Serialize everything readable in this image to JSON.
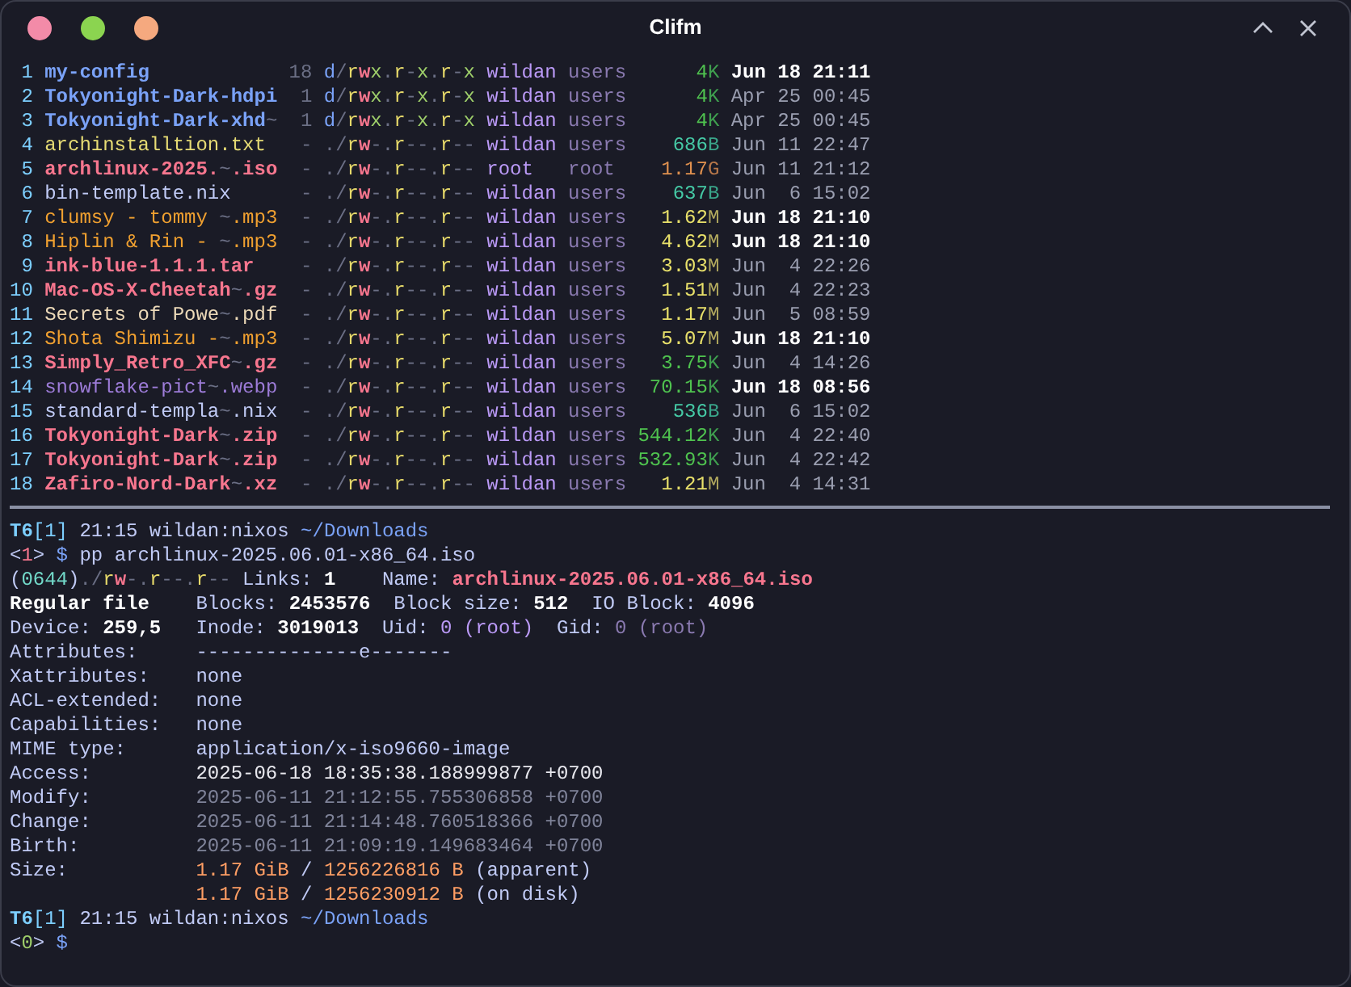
{
  "window": {
    "title": "Clifm"
  },
  "listing": [
    {
      "index": "1",
      "name": "my-config",
      "kind": "dir",
      "links": "18",
      "perms": "d/rwx.r-x.r-x",
      "owner": "wildan",
      "group": "users",
      "size": "4",
      "unit": "K",
      "date": "Jun 18 21:11",
      "recent": true
    },
    {
      "index": "2",
      "name": "Tokyonight-Dark-hdpi",
      "kind": "dir",
      "links": "1",
      "perms": "d/rwx.r-x.r-x",
      "owner": "wildan",
      "group": "users",
      "size": "4",
      "unit": "K",
      "date": "Apr 25 00:45",
      "recent": false
    },
    {
      "index": "3",
      "name": "Tokyonight-Dark-xhd~",
      "kind": "dir",
      "links": "1",
      "perms": "d/rwx.r-x.r-x",
      "owner": "wildan",
      "group": "users",
      "size": "4",
      "unit": "K",
      "date": "Apr 25 00:45",
      "recent": false
    },
    {
      "index": "4",
      "name": "archinstalltion.txt",
      "kind": "text",
      "links": "-",
      "perms": "./rw-.r--.r--",
      "owner": "wildan",
      "group": "users",
      "size": "686",
      "unit": "B",
      "date": "Jun 11 22:47",
      "recent": false
    },
    {
      "index": "5",
      "name": "archlinux-2025.~.iso",
      "kind": "archive",
      "links": "-",
      "perms": "./rw-.r--.r--",
      "owner": "root",
      "group": "root",
      "size": "1.17",
      "unit": "G",
      "date": "Jun 11 21:12",
      "recent": false
    },
    {
      "index": "6",
      "name": "bin-template.nix",
      "kind": "plain",
      "links": "-",
      "perms": "./rw-.r--.r--",
      "owner": "wildan",
      "group": "users",
      "size": "637",
      "unit": "B",
      "date": "Jun  6 15:02",
      "recent": false
    },
    {
      "index": "7",
      "name": "clumsy - tommy ~.mp3",
      "kind": "audio",
      "links": "-",
      "perms": "./rw-.r--.r--",
      "owner": "wildan",
      "group": "users",
      "size": "1.62",
      "unit": "M",
      "date": "Jun 18 21:10",
      "recent": true
    },
    {
      "index": "8",
      "name": "Hiplin & Rin - ~.mp3",
      "kind": "audio",
      "links": "-",
      "perms": "./rw-.r--.r--",
      "owner": "wildan",
      "group": "users",
      "size": "4.62",
      "unit": "M",
      "date": "Jun 18 21:10",
      "recent": true
    },
    {
      "index": "9",
      "name": "ink-blue-1.1.1.tar",
      "kind": "archive",
      "links": "-",
      "perms": "./rw-.r--.r--",
      "owner": "wildan",
      "group": "users",
      "size": "3.03",
      "unit": "M",
      "date": "Jun  4 22:26",
      "recent": false
    },
    {
      "index": "10",
      "name": "Mac-OS-X-Cheetah~.gz",
      "kind": "archive",
      "links": "-",
      "perms": "./rw-.r--.r--",
      "owner": "wildan",
      "group": "users",
      "size": "1.51",
      "unit": "M",
      "date": "Jun  4 22:23",
      "recent": false
    },
    {
      "index": "11",
      "name": "Secrets of Powe~.pdf",
      "kind": "document",
      "links": "-",
      "perms": "./rw-.r--.r--",
      "owner": "wildan",
      "group": "users",
      "size": "1.17",
      "unit": "M",
      "date": "Jun  5 08:59",
      "recent": false
    },
    {
      "index": "12",
      "name": "Shota Shimizu -~.mp3",
      "kind": "audio",
      "links": "-",
      "perms": "./rw-.r--.r--",
      "owner": "wildan",
      "group": "users",
      "size": "5.07",
      "unit": "M",
      "date": "Jun 18 21:10",
      "recent": true
    },
    {
      "index": "13",
      "name": "Simply_Retro_XFC~.gz",
      "kind": "archive",
      "links": "-",
      "perms": "./rw-.r--.r--",
      "owner": "wildan",
      "group": "users",
      "size": "3.75",
      "unit": "K",
      "date": "Jun  4 14:26",
      "recent": false
    },
    {
      "index": "14",
      "name": "snowflake-pict~.webp",
      "kind": "image",
      "links": "-",
      "perms": "./rw-.r--.r--",
      "owner": "wildan",
      "group": "users",
      "size": "70.15",
      "unit": "K",
      "date": "Jun 18 08:56",
      "recent": true
    },
    {
      "index": "15",
      "name": "standard-templa~.nix",
      "kind": "plain",
      "links": "-",
      "perms": "./rw-.r--.r--",
      "owner": "wildan",
      "group": "users",
      "size": "536",
      "unit": "B",
      "date": "Jun  6 15:02",
      "recent": false
    },
    {
      "index": "16",
      "name": "Tokyonight-Dark~.zip",
      "kind": "archive",
      "links": "-",
      "perms": "./rw-.r--.r--",
      "owner": "wildan",
      "group": "users",
      "size": "544.12",
      "unit": "K",
      "date": "Jun  4 22:40",
      "recent": false
    },
    {
      "index": "17",
      "name": "Tokyonight-Dark~.zip",
      "kind": "archive",
      "links": "-",
      "perms": "./rw-.r--.r--",
      "owner": "wildan",
      "group": "users",
      "size": "532.93",
      "unit": "K",
      "date": "Jun  4 22:42",
      "recent": false
    },
    {
      "index": "18",
      "name": "Zafiro-Nord-Dark~.xz",
      "kind": "archive",
      "links": "-",
      "perms": "./rw-.r--.r--",
      "owner": "wildan",
      "group": "users",
      "size": "1.21",
      "unit": "M",
      "date": "Jun  4 14:31",
      "recent": false
    }
  ],
  "output": [
    {
      "kind": "line",
      "segments": [
        {
          "text": "T6",
          "kind": "tab"
        },
        {
          "text": "[1]",
          "kind": "workspace"
        },
        {
          "text": " 21:15 wildan:nixos ",
          "kind": "text"
        },
        {
          "text": "~/Downloads",
          "kind": "path"
        }
      ]
    },
    {
      "kind": "line",
      "segments": [
        {
          "text": "<",
          "kind": "text"
        },
        {
          "text": "1",
          "kind": "error"
        },
        {
          "text": ">",
          "kind": "text"
        },
        {
          "text": " $",
          "kind": "prompt"
        },
        {
          "text": " pp archlinux-2025.06.01-x86_64.iso",
          "kind": "text"
        }
      ]
    },
    {
      "kind": "line",
      "segments": [
        {
          "text": "(",
          "kind": "text"
        },
        {
          "text": "0644",
          "kind": "octal"
        },
        {
          "text": ")",
          "kind": "text"
        },
        {
          "text": "./rw-.r--.r--",
          "kind": "perms"
        },
        {
          "text": " Links: ",
          "kind": "text"
        },
        {
          "text": "1",
          "kind": "value"
        },
        {
          "text": "    Name: ",
          "kind": "text"
        },
        {
          "text": "archlinux-2025.06.01-x86_64.iso",
          "kind": "filename"
        }
      ]
    },
    {
      "kind": "field",
      "label": [
        {
          "text": "Regular file",
          "kind": "value"
        }
      ],
      "value": [
        {
          "text": "Blocks: ",
          "kind": "text"
        },
        {
          "text": "2453576",
          "kind": "value"
        },
        {
          "text": "  Block size: ",
          "kind": "text"
        },
        {
          "text": "512",
          "kind": "value"
        },
        {
          "text": "  IO Block: ",
          "kind": "text"
        },
        {
          "text": "4096",
          "kind": "value"
        }
      ]
    },
    {
      "kind": "field",
      "label": [
        {
          "text": "Device: ",
          "kind": "text"
        },
        {
          "text": "259,5",
          "kind": "value"
        }
      ],
      "value": [
        {
          "text": "Inode: ",
          "kind": "text"
        },
        {
          "text": "3019013",
          "kind": "value"
        },
        {
          "text": "  Uid: ",
          "kind": "text"
        },
        {
          "text": "0 (root)",
          "kind": "user"
        },
        {
          "text": "  Gid: ",
          "kind": "text"
        },
        {
          "text": "0 (root)",
          "kind": "group"
        }
      ]
    },
    {
      "kind": "field",
      "label": [
        {
          "text": "Attributes:",
          "kind": "text"
        }
      ],
      "value": [
        {
          "text": "--------------e-------",
          "kind": "text"
        }
      ]
    },
    {
      "kind": "field",
      "label": [
        {
          "text": "Xattributes:",
          "kind": "text"
        }
      ],
      "value": [
        {
          "text": "none",
          "kind": "text"
        }
      ]
    },
    {
      "kind": "field",
      "label": [
        {
          "text": "ACL-extended:",
          "kind": "text"
        }
      ],
      "value": [
        {
          "text": "none",
          "kind": "text"
        }
      ]
    },
    {
      "kind": "field",
      "label": [
        {
          "text": "Capabilities:",
          "kind": "text"
        }
      ],
      "value": [
        {
          "text": "none",
          "kind": "text"
        }
      ]
    },
    {
      "kind": "field",
      "label": [
        {
          "text": "MIME type:",
          "kind": "text"
        }
      ],
      "value": [
        {
          "text": "application/x-iso9660-image",
          "kind": "text"
        }
      ]
    },
    {
      "kind": "field",
      "label": [
        {
          "text": "Access:",
          "kind": "text"
        }
      ],
      "value": [
        {
          "text": "2025-06-18 18:35:38.188999877 +0700",
          "kind": "access"
        }
      ]
    },
    {
      "kind": "field",
      "label": [
        {
          "text": "Modify:",
          "kind": "text"
        }
      ],
      "value": [
        {
          "text": "2025-06-11 21:12:55.755306858 +0700",
          "kind": "timestamp"
        }
      ]
    },
    {
      "kind": "field",
      "label": [
        {
          "text": "Change:",
          "kind": "text"
        }
      ],
      "value": [
        {
          "text": "2025-06-11 21:14:48.760518366 +0700",
          "kind": "timestamp"
        }
      ]
    },
    {
      "kind": "field",
      "label": [
        {
          "text": "Birth:",
          "kind": "text"
        }
      ],
      "value": [
        {
          "text": "2025-06-11 21:09:19.149683464 +0700",
          "kind": "timestamp"
        }
      ]
    },
    {
      "kind": "field",
      "label": [
        {
          "text": "Size:",
          "kind": "text"
        }
      ],
      "value": [
        {
          "text": "1.17 GiB",
          "kind": "size"
        },
        {
          "text": " / ",
          "kind": "text"
        },
        {
          "text": "1256226816 B",
          "kind": "size"
        },
        {
          "text": " (apparent)",
          "kind": "text"
        }
      ]
    },
    {
      "kind": "field",
      "value": [
        {
          "text": "1.17 GiB",
          "kind": "size"
        },
        {
          "text": " / ",
          "kind": "text"
        },
        {
          "text": "1256230912 B",
          "kind": "size"
        },
        {
          "text": " (on disk)",
          "kind": "text"
        }
      ]
    },
    {
      "kind": "line",
      "segments": [
        {
          "text": "T6",
          "kind": "tab"
        },
        {
          "text": "[1]",
          "kind": "workspace"
        },
        {
          "text": " 21:15 wildan:nixos ",
          "kind": "text"
        },
        {
          "text": "~/Downloads",
          "kind": "path"
        }
      ]
    },
    {
      "kind": "line",
      "segments": [
        {
          "text": "<",
          "kind": "text"
        },
        {
          "text": "0",
          "kind": "success"
        },
        {
          "text": ">",
          "kind": "text"
        },
        {
          "text": " $",
          "kind": "prompt"
        }
      ]
    }
  ]
}
